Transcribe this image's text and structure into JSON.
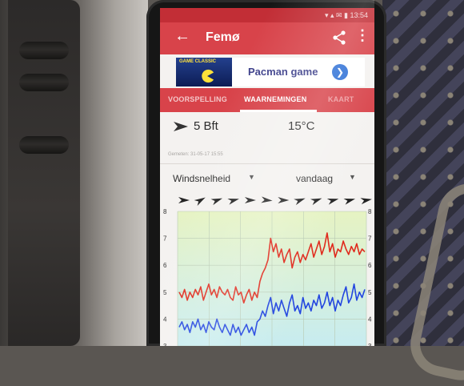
{
  "status_bar": {
    "icons": "▾ ▴ ✉ ▮ 13:54"
  },
  "toolbar": {
    "back_icon": "arrow-left-icon",
    "title": "Femø",
    "share_icon": "share-icon",
    "more_icon": "more-vertical-icon"
  },
  "ad": {
    "image_label": "GAME CLASSIC",
    "text": "Pacman game",
    "arrow_icon": "chevron-right-icon"
  },
  "tabs": [
    {
      "label": "VOORSPELLING",
      "active": false
    },
    {
      "label": "WAARNEMINGEN",
      "active": true
    },
    {
      "label": "KAART",
      "active": false
    }
  ],
  "observation": {
    "wind": "5 Bft",
    "temperature": "15°C",
    "measured_at": "Gemeten: 31-05-17 15:55"
  },
  "selectors": {
    "parameter": "Windsnelheid",
    "period": "vandaag"
  },
  "chart_data": {
    "type": "line",
    "left_axis_ticks": [
      "8",
      "7",
      "6",
      "5",
      "4",
      "3"
    ],
    "right_axis_ticks": [
      "8",
      "7",
      "6",
      "5",
      "4",
      "3"
    ],
    "left_ylim": [
      3,
      8
    ],
    "direction_arrows_deg": [
      0,
      -30,
      -20,
      -15,
      0,
      5,
      0,
      -20,
      -20,
      -15,
      -15,
      -10
    ],
    "series": [
      {
        "color": "#e02a1c",
        "values": [
          5.0,
          4.8,
          5.1,
          4.7,
          5.0,
          4.8,
          5.1,
          4.9,
          5.2,
          4.7,
          5.0,
          5.3,
          4.9,
          5.1,
          4.8,
          5.2,
          5.0,
          4.9,
          5.1,
          4.8,
          4.7,
          5.2,
          4.9,
          5.0,
          4.6,
          4.9,
          5.1,
          4.7,
          5.0,
          4.8,
          5.4,
          5.7,
          5.9,
          6.2,
          7.0,
          6.5,
          6.8,
          6.3,
          6.6,
          6.1,
          6.4,
          6.6,
          5.9,
          6.3,
          6.5,
          6.1,
          6.4,
          6.2,
          6.5,
          6.8,
          6.3,
          6.6,
          6.9,
          6.4,
          6.7,
          7.2,
          6.5,
          6.8,
          6.3,
          6.6,
          6.5,
          6.9,
          6.6,
          6.4,
          6.7,
          6.5,
          6.8,
          6.4,
          6.6,
          6.5
        ]
      },
      {
        "color": "#2245e0",
        "values": [
          3.7,
          3.9,
          3.6,
          3.8,
          3.5,
          3.9,
          3.7,
          4.0,
          3.6,
          3.8,
          3.5,
          3.9,
          3.7,
          3.6,
          4.0,
          3.7,
          3.5,
          3.8,
          3.6,
          3.4,
          3.8,
          3.5,
          3.7,
          3.4,
          3.6,
          3.8,
          3.5,
          3.7,
          3.4,
          3.9,
          4.0,
          4.3,
          4.1,
          4.5,
          4.8,
          4.2,
          4.6,
          4.3,
          4.7,
          4.4,
          4.1,
          4.6,
          4.9,
          4.3,
          4.5,
          4.2,
          4.8,
          4.4,
          4.6,
          4.3,
          4.7,
          4.5,
          4.9,
          4.4,
          4.6,
          5.0,
          4.5,
          4.8,
          4.3,
          4.7,
          4.5,
          4.9,
          5.2,
          4.6,
          4.8,
          5.3,
          4.7,
          5.0,
          4.8,
          5.1
        ]
      }
    ]
  }
}
